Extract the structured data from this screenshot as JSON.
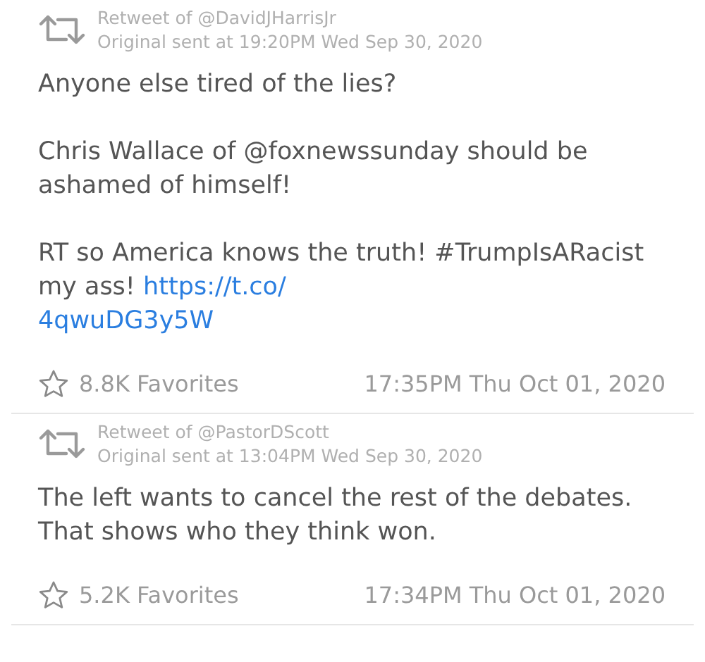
{
  "tweets": [
    {
      "retweet_of": "Retweet of @DavidJHarrisJr",
      "original_sent": "Original sent at 19:20PM Wed Sep 30, 2020",
      "paragraphs": [
        {
          "text": "Anyone else tired of the lies?"
        },
        {
          "text": "Chris Wallace of @foxnewssunday should be ashamed of himself!"
        },
        {
          "text": "RT so America knows the truth! #TrumpIsARacist my ass!",
          "link_parts": [
            "https://t.co/",
            "4qwuDG3y5W"
          ]
        }
      ],
      "favorites": "8.8K Favorites",
      "time": "17:35PM Thu Oct 01, 2020"
    },
    {
      "retweet_of": "Retweet of @PastorDScott",
      "original_sent": "Original sent at 13:04PM Wed Sep 30, 2020",
      "paragraphs": [
        {
          "text": "The left wants to cancel the rest of the debates. That shows who they think won."
        }
      ],
      "favorites": "5.2K Favorites",
      "time": "17:34PM Thu Oct 01, 2020"
    }
  ]
}
